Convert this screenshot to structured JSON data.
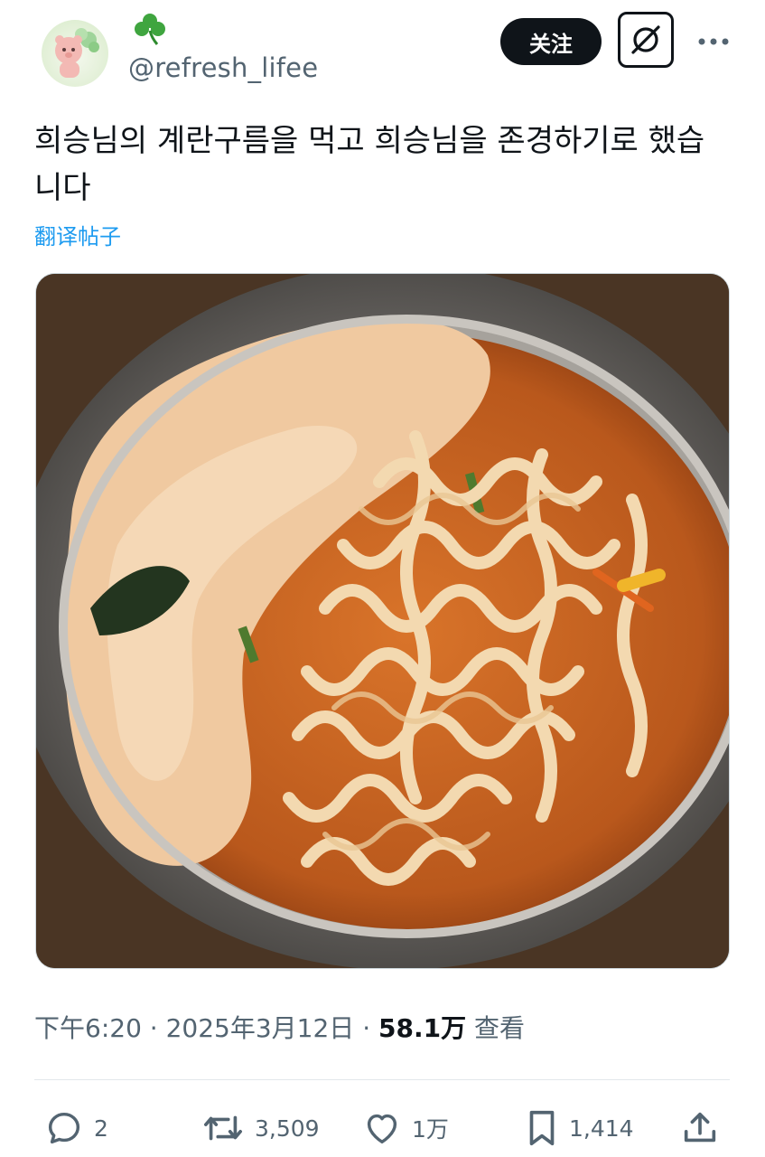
{
  "author": {
    "name_emoji": "☘️",
    "handle": "@refresh_lifee",
    "avatar_icon": "bear-clover-avatar"
  },
  "header": {
    "follow_label": "关注",
    "grok_icon": "grok-icon",
    "more_icon": "more-icon"
  },
  "post": {
    "text": "희승님의 계란구름을 먹고 희승님을 존경하기로 했습니다",
    "translate_label": "翻译帖子",
    "photo_icon": "ramen-photo"
  },
  "meta": {
    "time": "下午6:20",
    "date": "2025年3月12日",
    "separator": "·",
    "views_count": "58.1万",
    "views_label": "查看"
  },
  "actions": {
    "reply_count": "2",
    "repost_count": "3,509",
    "like_count": "1万",
    "bookmark_count": "1,414"
  },
  "colors": {
    "accent": "#1d9bf0",
    "text": "#0f1419",
    "muted": "#536471"
  }
}
